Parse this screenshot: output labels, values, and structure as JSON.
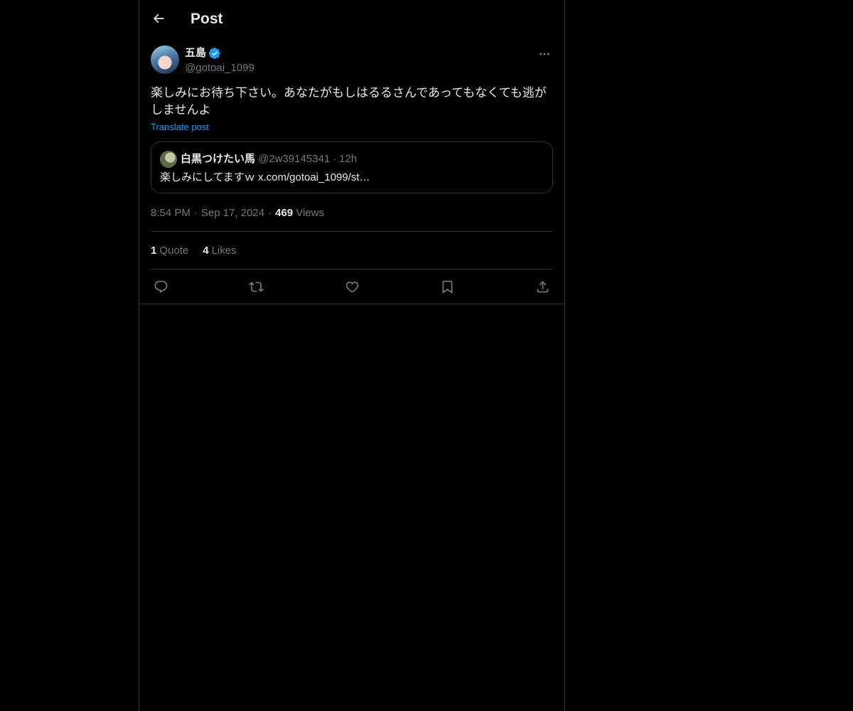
{
  "header": {
    "title": "Post",
    "back_icon": "arrow-left-icon"
  },
  "post": {
    "author": {
      "display_name": "五島",
      "handle": "@gotoai_1099",
      "verified": true
    },
    "text": "楽しみにお待ち下さい。あなたがもしはるるさんであってもなくても逃がしませんよ",
    "translate_label": "Translate post",
    "quoted": {
      "display_name": "白黒つけたい馬",
      "handle": "@2w39145341",
      "separator": "·",
      "time": "12h",
      "text": "楽しみにしてますｗ x.com/gotoai_1099/st…"
    },
    "meta": {
      "time": "8:54 PM",
      "sep1": "·",
      "date": "Sep 17, 2024",
      "sep2": "·",
      "views_count": "469",
      "views_label": "Views"
    },
    "stats": {
      "quotes_count": "1",
      "quotes_label": "Quote",
      "likes_count": "4",
      "likes_label": "Likes"
    }
  },
  "icons": {
    "reply": "reply-icon",
    "repost": "repost-icon",
    "like": "heart-icon",
    "bookmark": "bookmark-icon",
    "share": "share-icon",
    "more": "more-horizontal-icon",
    "verified": "verified-badge-icon"
  },
  "colors": {
    "background": "#000000",
    "text": "#e7e9ea",
    "secondary": "#71767b",
    "accent": "#1d9bf0",
    "border": "#2f3336"
  }
}
